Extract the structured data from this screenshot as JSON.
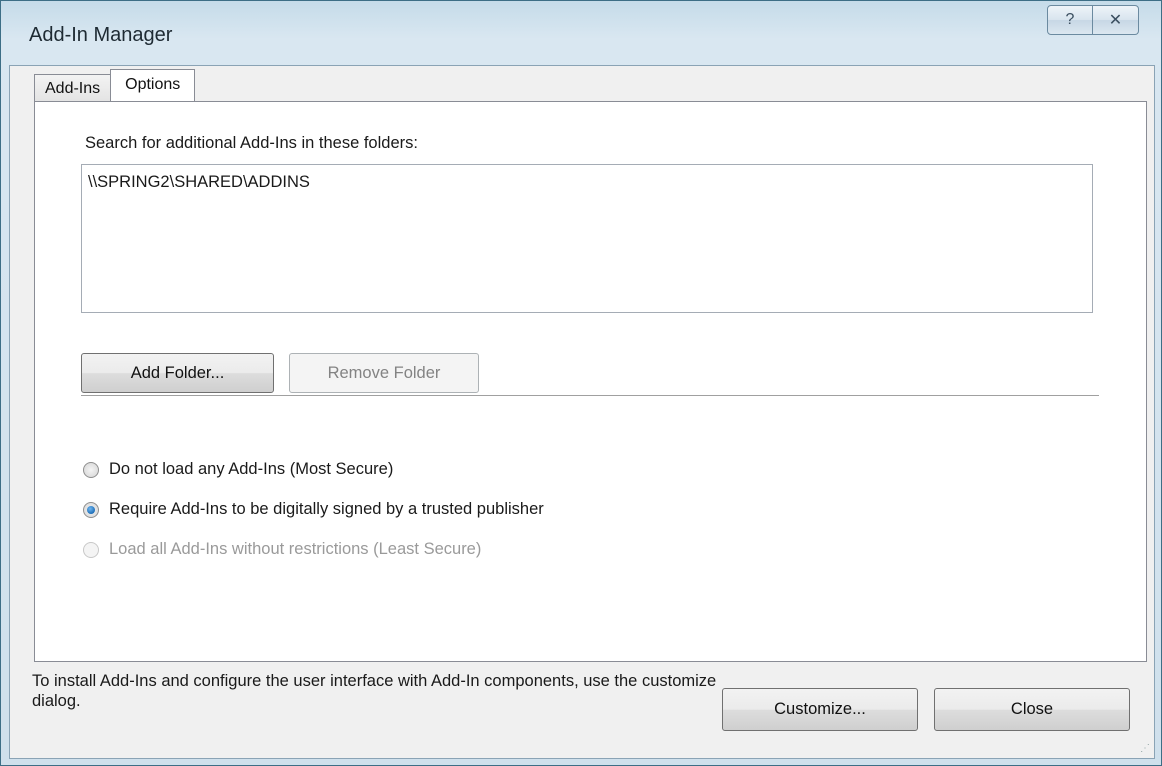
{
  "window": {
    "title": "Add-In Manager",
    "help_glyph": "?",
    "close_glyph": "✕"
  },
  "tabs": [
    {
      "label": "Add-Ins",
      "active": false
    },
    {
      "label": "Options",
      "active": true
    }
  ],
  "options": {
    "search_label": "Search for additional Add-Ins in these folders:",
    "folders": [
      "\\\\SPRING2\\SHARED\\ADDINS"
    ],
    "add_folder_label": "Add Folder...",
    "remove_folder_label": "Remove Folder",
    "radios": [
      {
        "label": "Do not load any Add-Ins (Most Secure)",
        "checked": false,
        "enabled": true
      },
      {
        "label": "Require Add-Ins to be digitally signed by a trusted publisher",
        "checked": true,
        "enabled": true
      },
      {
        "label": "Load all Add-Ins without restrictions (Least Secure)",
        "checked": false,
        "enabled": false
      }
    ]
  },
  "footer": {
    "text": "To install Add-Ins and configure the user interface with Add-In components, use the customize dialog.",
    "customize_label": "Customize...",
    "close_label": "Close"
  },
  "colors": {
    "accent": "#1565b0",
    "desktop": "#1f6f7a"
  }
}
